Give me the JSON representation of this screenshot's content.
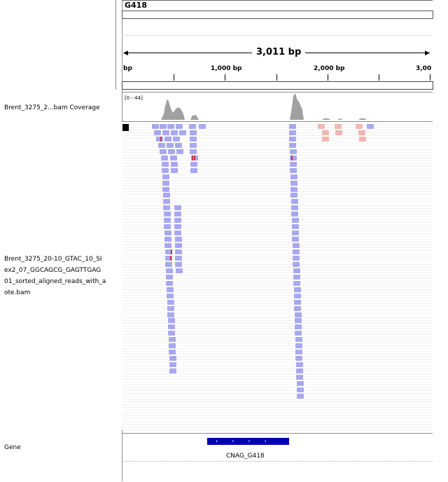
{
  "ruler": {
    "chromosome": "G418",
    "span_label": "3,011 bp",
    "ticks": [
      "bp",
      "1,000 bp",
      "2,000 bp",
      "3,00"
    ]
  },
  "tracks": {
    "coverage_name": "Brent_3275_2...bam Coverage",
    "coverage_range": "[0 - 44]",
    "alignment_name_lines": [
      "Brent_3275_20-10_GTAC_10_SI",
      "ex2_07_GGCAGCG_GAGTTGAG",
      "01_sorted_aligned_reads_with_a",
      "ote.bam"
    ],
    "gene_track_name": "Gene"
  },
  "gene": {
    "name": "CNAG_G418",
    "strand_glyphs": "››››"
  },
  "colors": {
    "read": "#a8a8f0",
    "read_pink": "#f0b8b0",
    "mismatch": "#c83050",
    "gene": "#0000b2",
    "coverage": "#a0a0a0"
  }
}
